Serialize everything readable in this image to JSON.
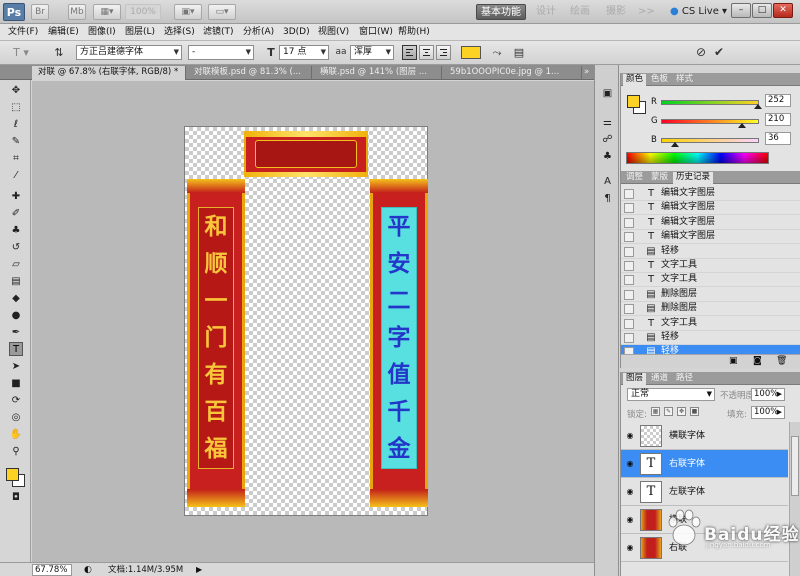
{
  "app": {
    "logo": "Ps",
    "bar_buttons": [
      "Br",
      "Mb"
    ],
    "zoom_display": "100%",
    "workspaces": [
      "基本功能",
      "设计",
      "绘画",
      "摄影"
    ],
    "more": ">>",
    "cs_live": "CS Live",
    "window_buttons": [
      "–",
      "□",
      "✕"
    ]
  },
  "menu": [
    "文件(F)",
    "编辑(E)",
    "图像(I)",
    "图层(L)",
    "选择(S)",
    "滤镜(T)",
    "分析(A)",
    "3D(D)",
    "视图(V)",
    "窗口(W)",
    "帮助(H)"
  ],
  "options": {
    "font_family": "方正吕建德字体",
    "font_style": "-",
    "font_size": "17 点",
    "aa_icon": "aa",
    "antialias": "浑厚",
    "text_color": "#fcd224"
  },
  "tabs": [
    {
      "label": "对联 @ 67.8% (右联字体, RGB/8) *",
      "active": true
    },
    {
      "label": "对联模板.psd @ 81.3% (..."
    },
    {
      "label": "横联.psd @ 141% (图层 ..."
    },
    {
      "label": "59b1OOOPIC0e.jpg @ 1..."
    }
  ],
  "tab_more": "»",
  "canvas": {
    "left_couplet": [
      "和",
      "顺",
      "一",
      "门",
      "有",
      "百",
      "福"
    ],
    "right_couplet": [
      "平",
      "安",
      "二",
      "字",
      "值",
      "千",
      "金"
    ]
  },
  "status": {
    "zoom": "67.78%",
    "doc": "文档:1.14M/3.95M"
  },
  "color_panel": {
    "tabs": [
      "颜色",
      "色板",
      "样式"
    ],
    "fg": "#fcd224",
    "r": {
      "label": "R",
      "value": "252",
      "level": 0.988
    },
    "g": {
      "label": "G",
      "value": "210",
      "level": 0.824
    },
    "b": {
      "label": "B",
      "value": "36",
      "level": 0.141
    }
  },
  "history_panel": {
    "tabs": [
      "调整",
      "蒙版",
      "历史记录"
    ],
    "items": [
      {
        "icon": "T",
        "label": "编辑文字图层"
      },
      {
        "icon": "T",
        "label": "编辑文字图层"
      },
      {
        "icon": "T",
        "label": "编辑文字图层"
      },
      {
        "icon": "T",
        "label": "编辑文字图层"
      },
      {
        "icon": "▤",
        "label": "轻移"
      },
      {
        "icon": "T",
        "label": "文字工具"
      },
      {
        "icon": "T",
        "label": "文字工具"
      },
      {
        "icon": "▤",
        "label": "删除图层"
      },
      {
        "icon": "▤",
        "label": "删除图层"
      },
      {
        "icon": "T",
        "label": "文字工具"
      },
      {
        "icon": "▤",
        "label": "轻移"
      },
      {
        "icon": "▤",
        "label": "轻移",
        "selected": true
      }
    ]
  },
  "layers_panel": {
    "tabs": [
      "图层",
      "通道",
      "路径"
    ],
    "blend_mode": "正常",
    "opacity_label": "不透明度:",
    "opacity": "100%",
    "lock_label": "锁定:",
    "fill_label": "填充:",
    "fill": "100%",
    "layers": [
      {
        "name": "横联字体",
        "thumb": "checker"
      },
      {
        "name": "右联字体",
        "thumb": "text",
        "selected": true
      },
      {
        "name": "左联字体",
        "thumb": "text"
      },
      {
        "name": "横联",
        "thumb": "red"
      },
      {
        "name": "右联",
        "thumb": "red"
      }
    ]
  },
  "watermark": {
    "text": "Baidu经验",
    "domain": "jingyan.baidu.com"
  }
}
